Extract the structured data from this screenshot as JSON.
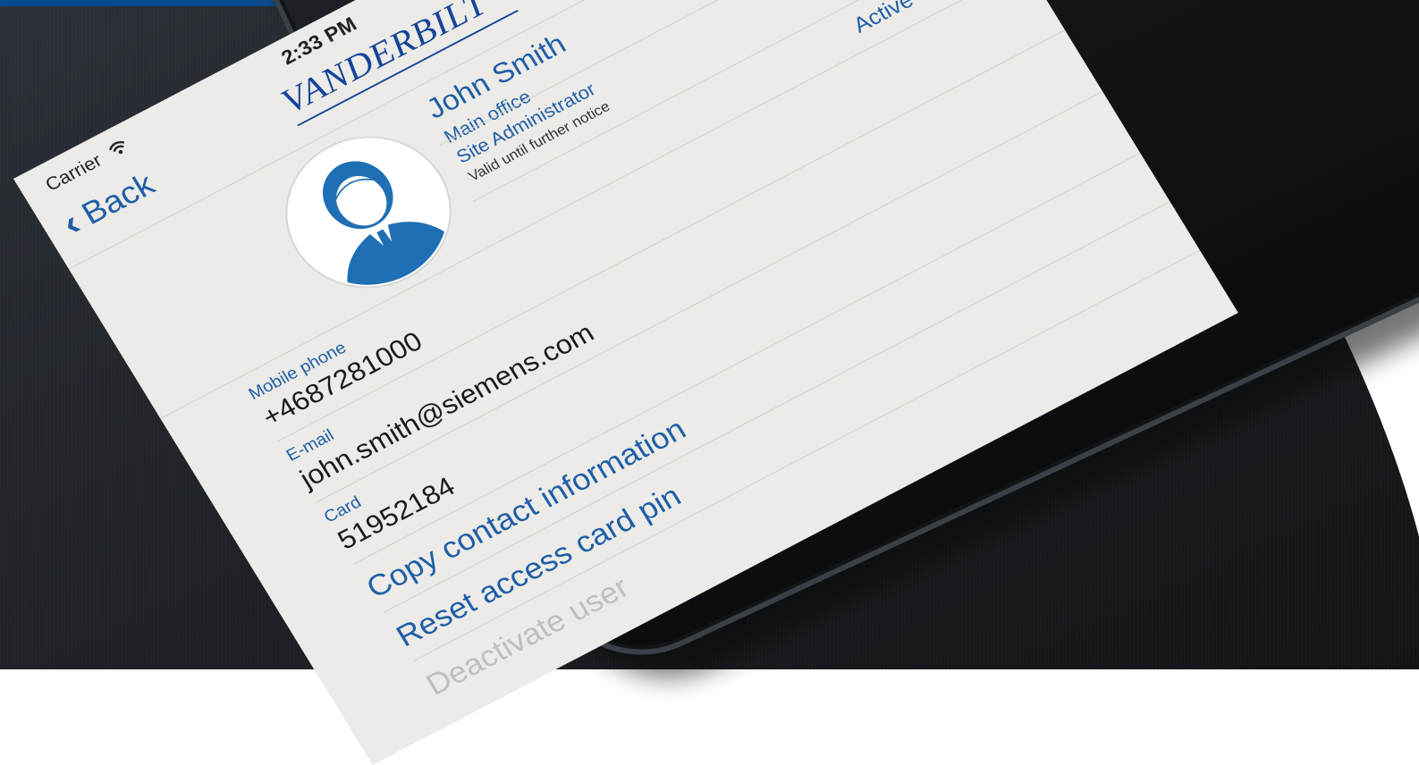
{
  "status_bar": {
    "carrier": "Carrier",
    "time": "2:33 PM"
  },
  "nav": {
    "back_label": "Back",
    "brand": "VANDERBILT"
  },
  "profile": {
    "name": "John Smith",
    "office": "Main office",
    "role": "Site Administrator",
    "validity": "Valid until further notice",
    "status": "Active"
  },
  "fields": [
    {
      "label": "Mobile phone",
      "value": "+4687281000"
    },
    {
      "label": "E-mail",
      "value": "john.smith@siemens.com"
    },
    {
      "label": "Card",
      "value": "51952184"
    }
  ],
  "actions": [
    {
      "label": "Copy contact information",
      "enabled": true
    },
    {
      "label": "Reset access card pin",
      "enabled": true
    },
    {
      "label": "Deactivate user",
      "enabled": false
    }
  ],
  "colors": {
    "accent": "#1f5fa8",
    "brand": "#16449a",
    "screen_bg": "#ecebe7",
    "disabled": "#bfbfbf",
    "top_rule": "#0a4a8e"
  },
  "icons": [
    "wifi-icon",
    "chevron-left-icon",
    "avatar-icon",
    "phone-icon",
    "edit-icon"
  ]
}
